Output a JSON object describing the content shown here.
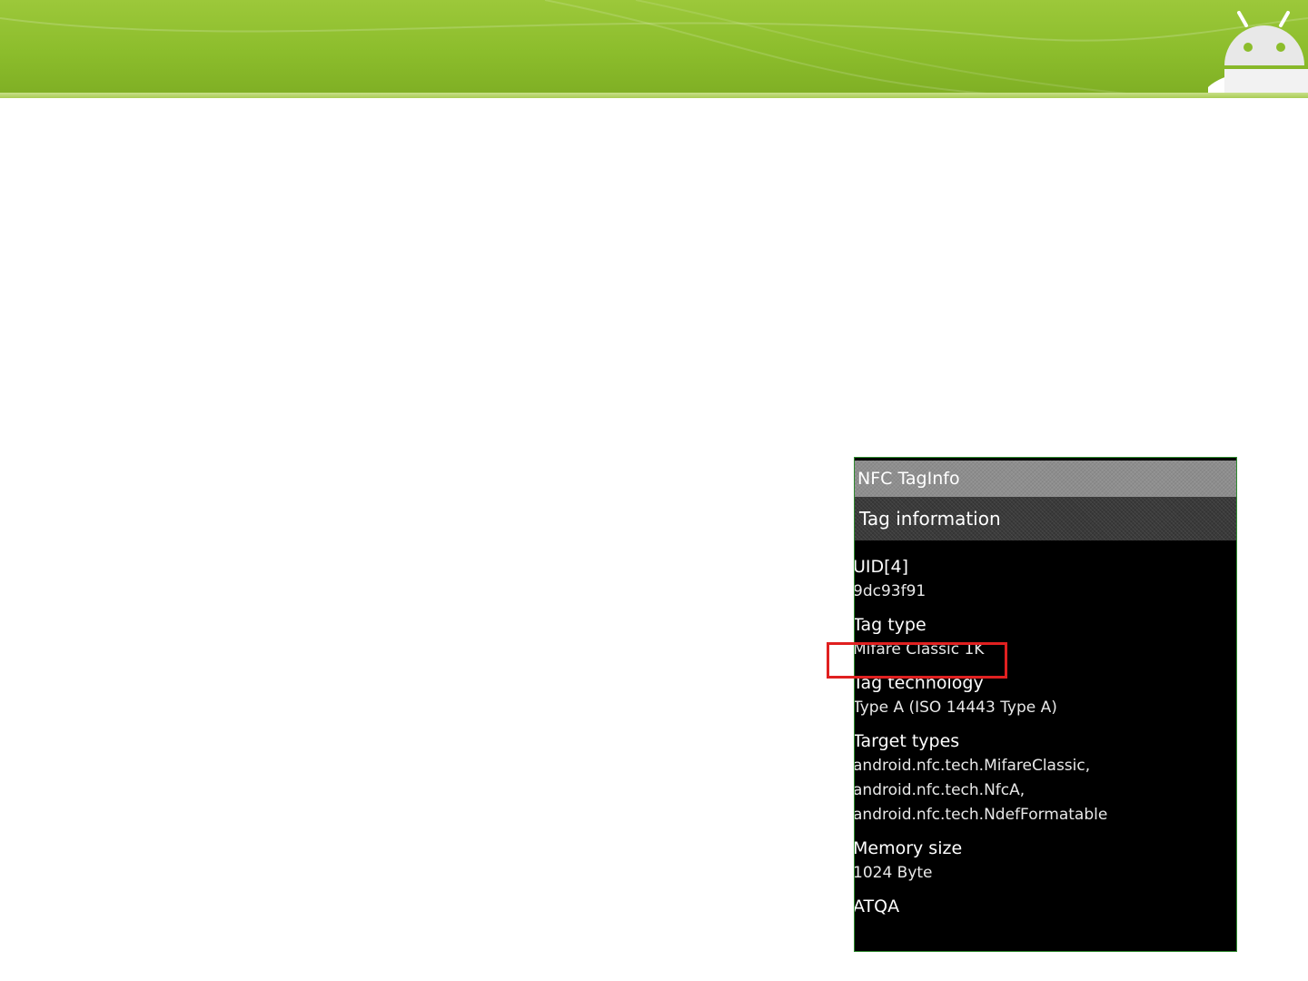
{
  "phone": {
    "app_title": "NFC TagInfo",
    "section_title": "Tag information",
    "fields": [
      {
        "label": "UID[4]",
        "values": [
          "9dc93f91"
        ]
      },
      {
        "label": "Tag type",
        "values": [
          "Mifare Classic 1K"
        ]
      },
      {
        "label": "Tag technology",
        "values": [
          "Type A (ISO 14443 Type A)"
        ]
      },
      {
        "label": "Target types",
        "values": [
          "android.nfc.tech.MifareClassic,",
          "android.nfc.tech.NfcA,",
          "android.nfc.tech.NdefFormatable"
        ]
      },
      {
        "label": "Memory size",
        "values": [
          "1024 Byte"
        ]
      },
      {
        "label": "ATQA",
        "values": []
      }
    ]
  },
  "colors": {
    "banner_green": "#8cbd2c",
    "highlight_red": "#e02020",
    "screen_black": "#000000"
  },
  "icons": {
    "banner_logo": "android-robot-icon"
  }
}
